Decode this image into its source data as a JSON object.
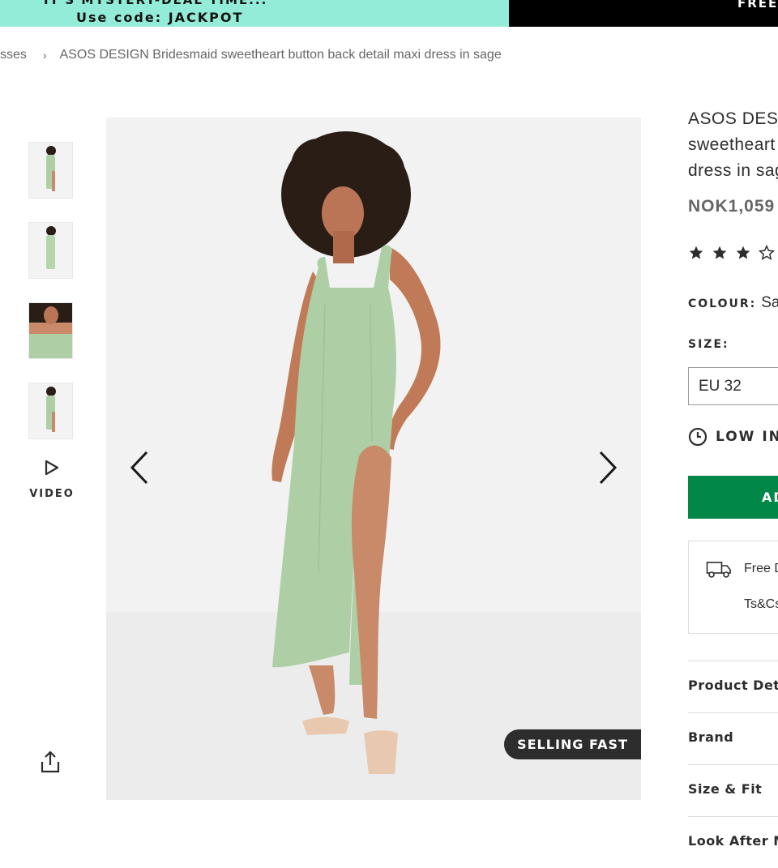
{
  "promo": {
    "line1": "IT'S MYSTERY-DEAL TIME...",
    "line2": "Use code: JACKPOT",
    "right_text": "FREE"
  },
  "breadcrumb": {
    "items": [
      "sses",
      "ASOS DESIGN Bridesmaid sweetheart button back detail maxi dress in sage"
    ],
    "separator": "›"
  },
  "gallery": {
    "thumbnails": [
      "full-length front",
      "full-length back",
      "close-up front",
      "full-length side"
    ],
    "video_label": "VIDEO",
    "badge": "SELLING FAST"
  },
  "product": {
    "title_lines": [
      "ASOS DESI",
      "sweetheart",
      "dress in sag"
    ],
    "price": "NOK1,059",
    "rating_stars_filled": 3,
    "rating_stars_shown": 4,
    "colour_label": "COLOUR:",
    "colour_value": "Sag",
    "size_label": "SIZE:",
    "size_value": "EU 32",
    "stock_text": "LOW IN",
    "add_button": "AD",
    "delivery_text": "Free D",
    "delivery_terms": "Ts&Cs"
  },
  "accordion": [
    "Product Deta",
    "Brand",
    "Size & Fit",
    "Look After M"
  ],
  "colors": {
    "promo_bg": "#92ecd7",
    "accent_green": "#018849",
    "dress_sage": "#aecfa6",
    "text": "#2d2d2d"
  },
  "icons": [
    "chevron-left-icon",
    "chevron-right-icon",
    "play-icon",
    "share-icon",
    "star-icon",
    "clock-icon",
    "truck-icon"
  ]
}
